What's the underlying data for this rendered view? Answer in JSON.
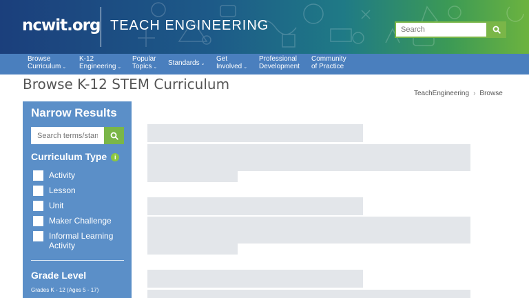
{
  "header": {
    "logo_text": "ncwit.org",
    "site_title": "TEACH ENGINEERING",
    "search_placeholder": "Search",
    "search_icon": "search-icon"
  },
  "nav": {
    "items": [
      {
        "line1": "Browse",
        "line2": "Curriculum",
        "caret": "⌄"
      },
      {
        "line1": "K-12",
        "line2": "Engineering",
        "caret": "⌄"
      },
      {
        "line1": "Popular",
        "line2": "Topics",
        "caret": "⌄"
      },
      {
        "line1": "Standards",
        "line2": "",
        "caret": "⌄"
      },
      {
        "line1": "Get",
        "line2": "Involved",
        "caret": "⌄"
      },
      {
        "line1": "Professional",
        "line2": "Development",
        "caret": ""
      },
      {
        "line1": "Community",
        "line2": "of Practice",
        "caret": ""
      }
    ]
  },
  "page": {
    "title": "Browse K-12 STEM Curriculum",
    "breadcrumb": [
      "TeachEngineering",
      "Browse"
    ],
    "breadcrumb_sep": "›"
  },
  "sidebar": {
    "heading": "Narrow Results",
    "search_placeholder": "Search terms/standards",
    "curriculum_type_label": "Curriculum Type",
    "info_glyph": "i",
    "curriculum_types": [
      {
        "label": "Activity",
        "checked": false
      },
      {
        "label": "Lesson",
        "checked": false
      },
      {
        "label": "Unit",
        "checked": false
      },
      {
        "label": "Maker Challenge",
        "checked": false
      },
      {
        "label": "Informal Learning Activity",
        "checked": false
      }
    ],
    "grade_level_label": "Grade Level",
    "grade_range": "Grades K - 12 (Ages 5 - 17)"
  },
  "colors": {
    "nav_bg": "#4a7fbe",
    "sidebar_bg": "#5b8fc8",
    "accent_green": "#7ab648",
    "skeleton": "#e3e6ea"
  }
}
